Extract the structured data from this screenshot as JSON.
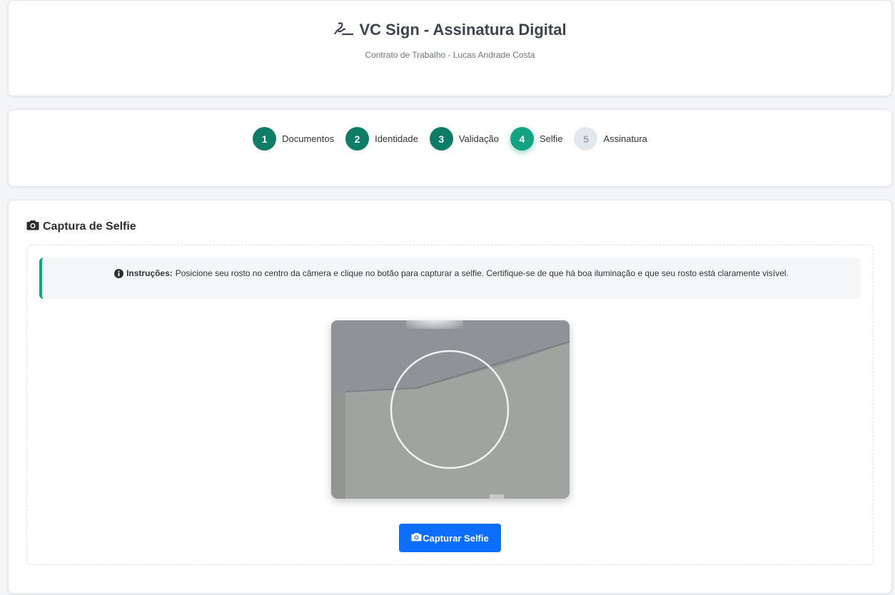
{
  "header": {
    "title": "VC Sign - Assinatura Digital",
    "subtitle": "Contrato de Trabalho - Lucas Andrade Costa",
    "icon": "signature-icon"
  },
  "steps": [
    {
      "number": "1",
      "label": "Documentos",
      "status": "completed"
    },
    {
      "number": "2",
      "label": "Identidade",
      "status": "completed"
    },
    {
      "number": "3",
      "label": "Validação",
      "status": "completed"
    },
    {
      "number": "4",
      "label": "Selfie",
      "status": "active"
    },
    {
      "number": "5",
      "label": "Assinatura",
      "status": "pending"
    }
  ],
  "selfie": {
    "section_title": "Captura de Selfie",
    "section_icon": "camera-icon",
    "instructions_label": "Instruções:",
    "instructions_text": "Posicione seu rosto no centro da câmera e clique no botão para capturar a selfie. Certifique-se de que há boa iluminação e que seu rosto está claramente visível.",
    "instructions_icon": "info-icon",
    "capture_button_label": "Capturar Selfie",
    "capture_button_icon": "camera-icon"
  },
  "colors": {
    "accent_green": "#0f7d66",
    "active_green": "#14a382",
    "pending_gray": "#e3e8ef",
    "primary_blue": "#0d6efd"
  }
}
